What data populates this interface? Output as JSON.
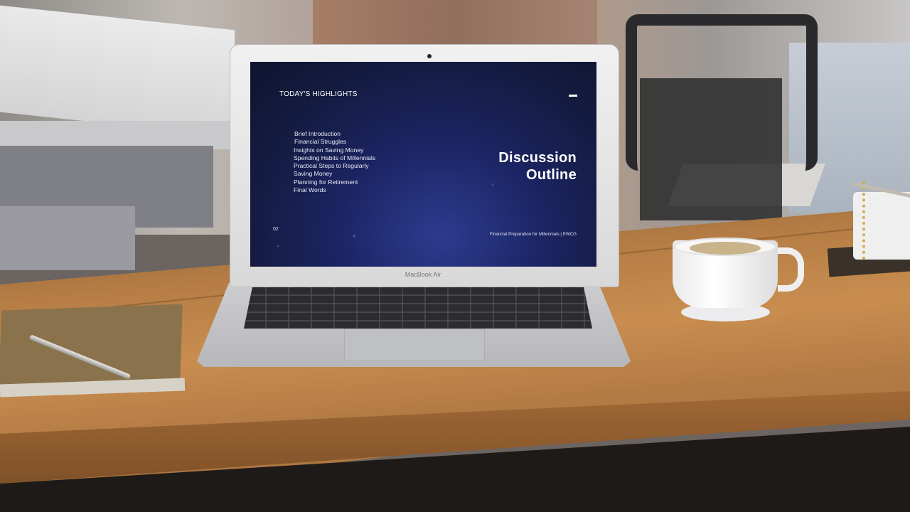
{
  "slide": {
    "header": "TODAY'S HIGHLIGHTS",
    "outline_items": [
      "Brief Introduction",
      "Financial Struggles",
      "Insights on Saving Money",
      "Spending Habits of Millennials",
      "Practical Steps to Regularly",
      "Saving Money",
      "Planning for Retirement",
      "Final Words"
    ],
    "title_line1": "Discussion",
    "title_line2": "Outline",
    "page_number": "02",
    "footer": "Financial Preparation for Millennials | EWCG"
  },
  "laptop": {
    "brand_label": "MacBook Air"
  }
}
